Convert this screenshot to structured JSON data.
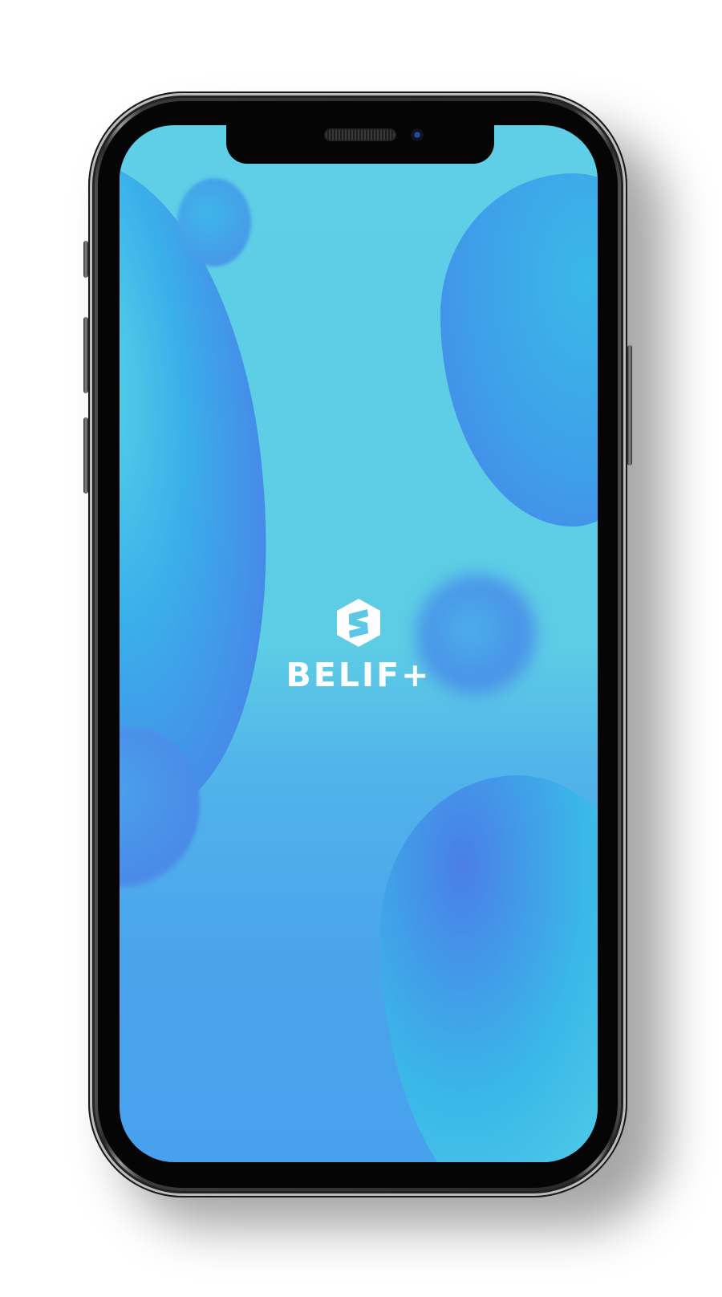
{
  "app": {
    "brand_name": "BELIF+",
    "logo_icon": "hexagon-s-logo-icon"
  },
  "colors": {
    "screen_top": "#5ecfe6",
    "screen_bottom": "#48a1ed",
    "blob_deep": "#4a7ee8",
    "blob_light": "#3ab7e8",
    "logo": "#ffffff"
  },
  "device": {
    "type": "smartphone-mockup"
  }
}
